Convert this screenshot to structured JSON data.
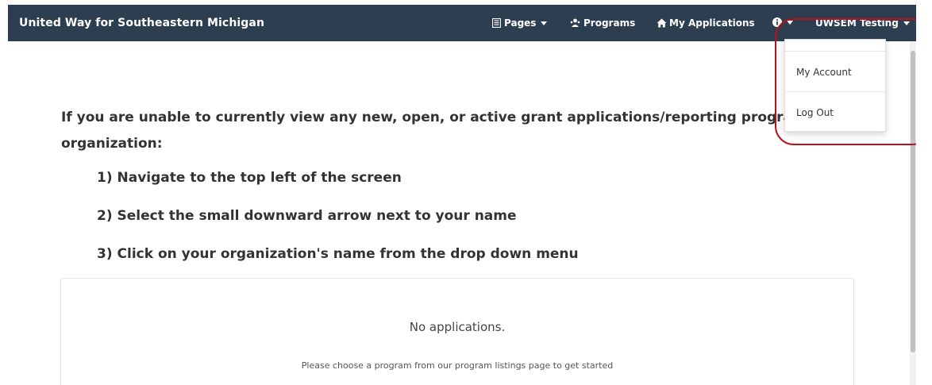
{
  "header": {
    "brand": "United Way for Southeastern Michigan",
    "nav": {
      "pages_label": "Pages",
      "programs_label": "Programs",
      "my_applications_label": "My Applications",
      "user_label": "UWSEM Testing"
    },
    "icons": {
      "pages": "document-icon",
      "programs": "people-icon",
      "my_applications": "home-icon",
      "info": "info-icon"
    }
  },
  "user_menu": {
    "items": [
      "My Account",
      "Log Out"
    ]
  },
  "main": {
    "intro": "If you are unable to currently view any new, open, or active grant applications/reporting programs for your organization:",
    "steps": [
      "1) Navigate to the top left of the screen",
      "2) Select the small downward arrow next to your name",
      "3) Click on your organization's name from the drop down menu"
    ],
    "empty_state": {
      "title": "No applications.",
      "subtitle": "Please choose a program from our program listings page to get started"
    }
  },
  "colors": {
    "navbar_bg": "#2d3e50",
    "highlight": "#b5121b"
  }
}
